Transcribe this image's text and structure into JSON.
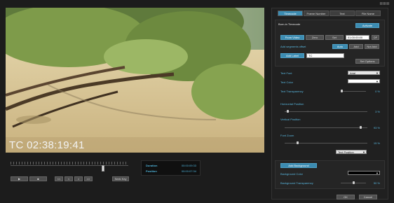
{
  "video": {
    "timecode": "TC 02:38:19:41"
  },
  "transport": {
    "play_icon": "play-icon",
    "stop_icon": "stop-icon",
    "buttons": [
      "<<",
      "<",
      ">",
      ">>"
    ],
    "seek_label": "Seek Key",
    "position_fraction": 0.79
  },
  "info": {
    "duration_label": "Duration",
    "duration_value": "00:00:09:33",
    "position_label": "Position",
    "position_value": "00:00:07:34"
  },
  "tabs": [
    {
      "label": "Timecode",
      "active": true
    },
    {
      "label": "Frame Number",
      "active": false
    },
    {
      "label": "Text",
      "active": false
    },
    {
      "label": "File Name",
      "active": false
    }
  ],
  "burn": {
    "title": "Burn-in Timecode",
    "activate_label": "Activate",
    "from_video": "From Video",
    "zero": "Zero",
    "set": "Set",
    "set_value": "01:00:00:00",
    "df": "DF",
    "offset_label": "Add segments offset",
    "offset_auto": "Auto",
    "offset_add": "Add",
    "offset_notadd": "Not Add",
    "add_label": "Add Label",
    "label_value": "TC",
    "set_options": "Set Options"
  },
  "style": {
    "font_label": "Text Font",
    "font_value": "Arial",
    "color_label": "Text Color",
    "transparency_label": "Text Transparency",
    "transparency_value": "0 %",
    "transparency_level": 0.0,
    "hpos_label": "Horizontal Position",
    "hpos_value": "3 %",
    "hpos_level": 0.03,
    "vpos_label": "Vertical Position",
    "vpos_value": "93 %",
    "vpos_level": 0.93,
    "zoom_label": "Font Zoom",
    "zoom_value": "15 %",
    "zoom_level": 0.15,
    "text_position": "Text Position"
  },
  "background": {
    "add_label": "Add Background",
    "color_label": "Background Color",
    "transparency_label": "Background Transparency",
    "transparency_value": "50 %",
    "transparency_level": 0.5
  },
  "footer": {
    "ok": "OK",
    "cancel": "Cancel"
  },
  "colors": {
    "accent": "#3c8cb2",
    "label": "#59b8e0"
  }
}
